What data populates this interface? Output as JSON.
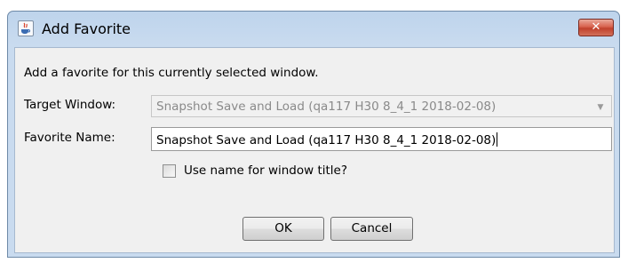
{
  "window": {
    "title": "Add Favorite",
    "close_glyph": "✕"
  },
  "icons": {
    "app": "java-app-icon",
    "close": "close-icon",
    "dropdown": "chevron-down-icon"
  },
  "form": {
    "intro": "Add a favorite for this currently selected window.",
    "target_window_label": "Target Window:",
    "target_window_value": "Snapshot Save and Load (qa117 H30 8_4_1 2018-02-08)",
    "favorite_name_label": "Favorite Name:",
    "favorite_name_value": "Snapshot Save and Load (qa117 H30 8_4_1 2018-02-08)",
    "use_name_checkbox_label": "Use name for window title?",
    "use_name_checked": false
  },
  "buttons": {
    "ok": "OK",
    "cancel": "Cancel"
  },
  "colors": {
    "title_bar": "#c9dbef",
    "close_button": "#c0412c",
    "client_bg": "#f0f0f0"
  }
}
